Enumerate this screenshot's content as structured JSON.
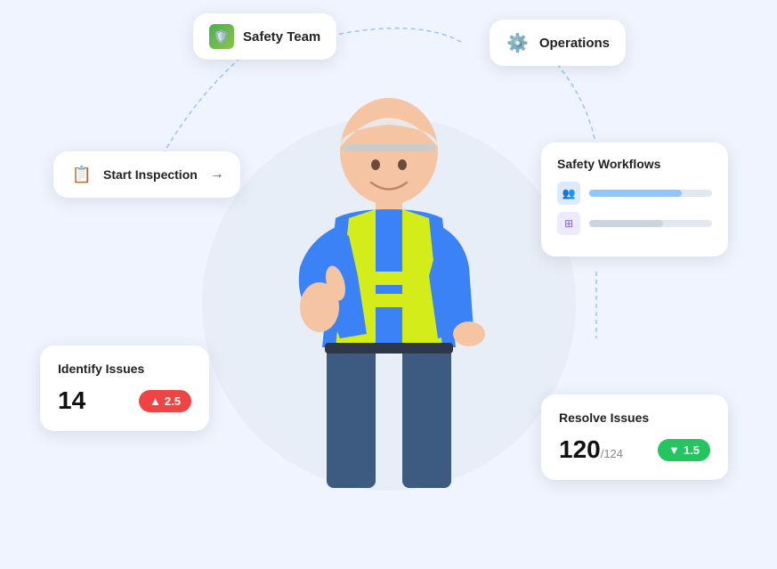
{
  "safety_team": {
    "label": "Safety Team",
    "icon": "shield"
  },
  "operations": {
    "label": "Operations",
    "icon": "gear"
  },
  "start_inspection": {
    "label": "Start Inspection",
    "arrow": "→"
  },
  "safety_workflows": {
    "title": "Safety Workflows",
    "items": [
      {
        "icon": "people",
        "type": "blue"
      },
      {
        "icon": "grid",
        "type": "purple"
      }
    ]
  },
  "identify_issues": {
    "title": "Identify Issues",
    "count": "14",
    "badge": "2.5",
    "badge_arrow": "▲"
  },
  "resolve_issues": {
    "title": "Resolve Issues",
    "count": "120",
    "sub": "/124",
    "badge": "1.5",
    "badge_arrow": "▼"
  }
}
